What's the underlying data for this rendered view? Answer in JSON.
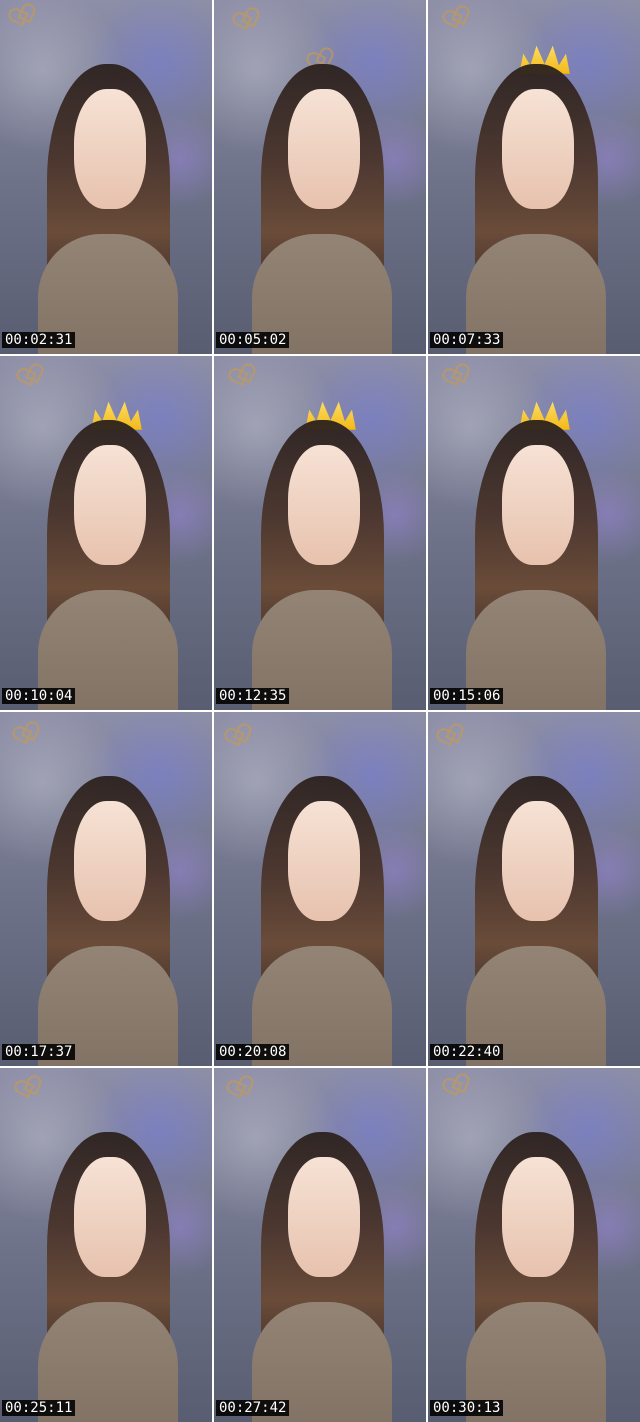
{
  "tiles": [
    {
      "time": "00:02:31"
    },
    {
      "time": "00:05:02"
    },
    {
      "time": "00:07:33"
    },
    {
      "time": "00:10:04"
    },
    {
      "time": "00:12:35"
    },
    {
      "time": "00:15:06"
    },
    {
      "time": "00:17:37"
    },
    {
      "time": "00:20:08"
    },
    {
      "time": "00:22:40"
    },
    {
      "time": "00:25:11"
    },
    {
      "time": "00:27:42"
    },
    {
      "time": "00:30:13"
    }
  ]
}
